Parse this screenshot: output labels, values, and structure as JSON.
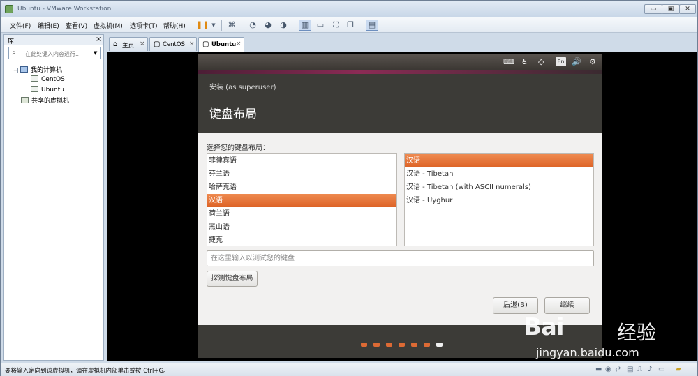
{
  "window": {
    "title": "Ubuntu - VMware Workstation",
    "btn_min": "▭",
    "btn_max": "▣",
    "btn_close": "✕"
  },
  "menu": {
    "file": "文件(F)",
    "edit": "编辑(E)",
    "view": "查看(V)",
    "vm": "虚拟机(M)",
    "tabs": "选项卡(T)",
    "help": "帮助(H)"
  },
  "library": {
    "title": "库",
    "close": "×",
    "search_placeholder": "在此处键入内容进行...",
    "tree": {
      "my_computer": "我的计算机",
      "centos": "CentOS",
      "ubuntu": "Ubuntu",
      "shared": "共享的虚拟机",
      "toggle": "−"
    }
  },
  "tabs": [
    {
      "label": "主页"
    },
    {
      "label": "CentOS"
    },
    {
      "label": "Ubuntu"
    }
  ],
  "tab_close": "×",
  "installer": {
    "subtitle": "安装 (as superuser)",
    "title": "键盘布局",
    "choose_label": "选择您的键盘布局：",
    "lang_badge": "En",
    "layouts_left": [
      "菲律宾语",
      "芬兰语",
      "哈萨克语",
      "汉语",
      "荷兰语",
      "黑山语",
      "捷克"
    ],
    "layouts_right": [
      "汉语",
      "汉语 - Tibetan",
      "汉语 - Tibetan (with ASCII numerals)",
      "汉语 - Uyghur"
    ],
    "selected_left": "汉语",
    "selected_right": "汉语",
    "test_placeholder": "在这里输入以测试您的键盘",
    "detect_button": "探测键盘布局",
    "back_button": "后退(B)",
    "continue_button": "继续",
    "progress_steps": 7,
    "current_step": 7,
    "accent_color": "#dd6326"
  },
  "status": {
    "text": "要将输入定向到该虚拟机，请在虚拟机内部单击或按 Ctrl+G。"
  },
  "watermark": {
    "brand": "Bai",
    "brand2": "经验",
    "url": "jingyan.baidu.com"
  }
}
